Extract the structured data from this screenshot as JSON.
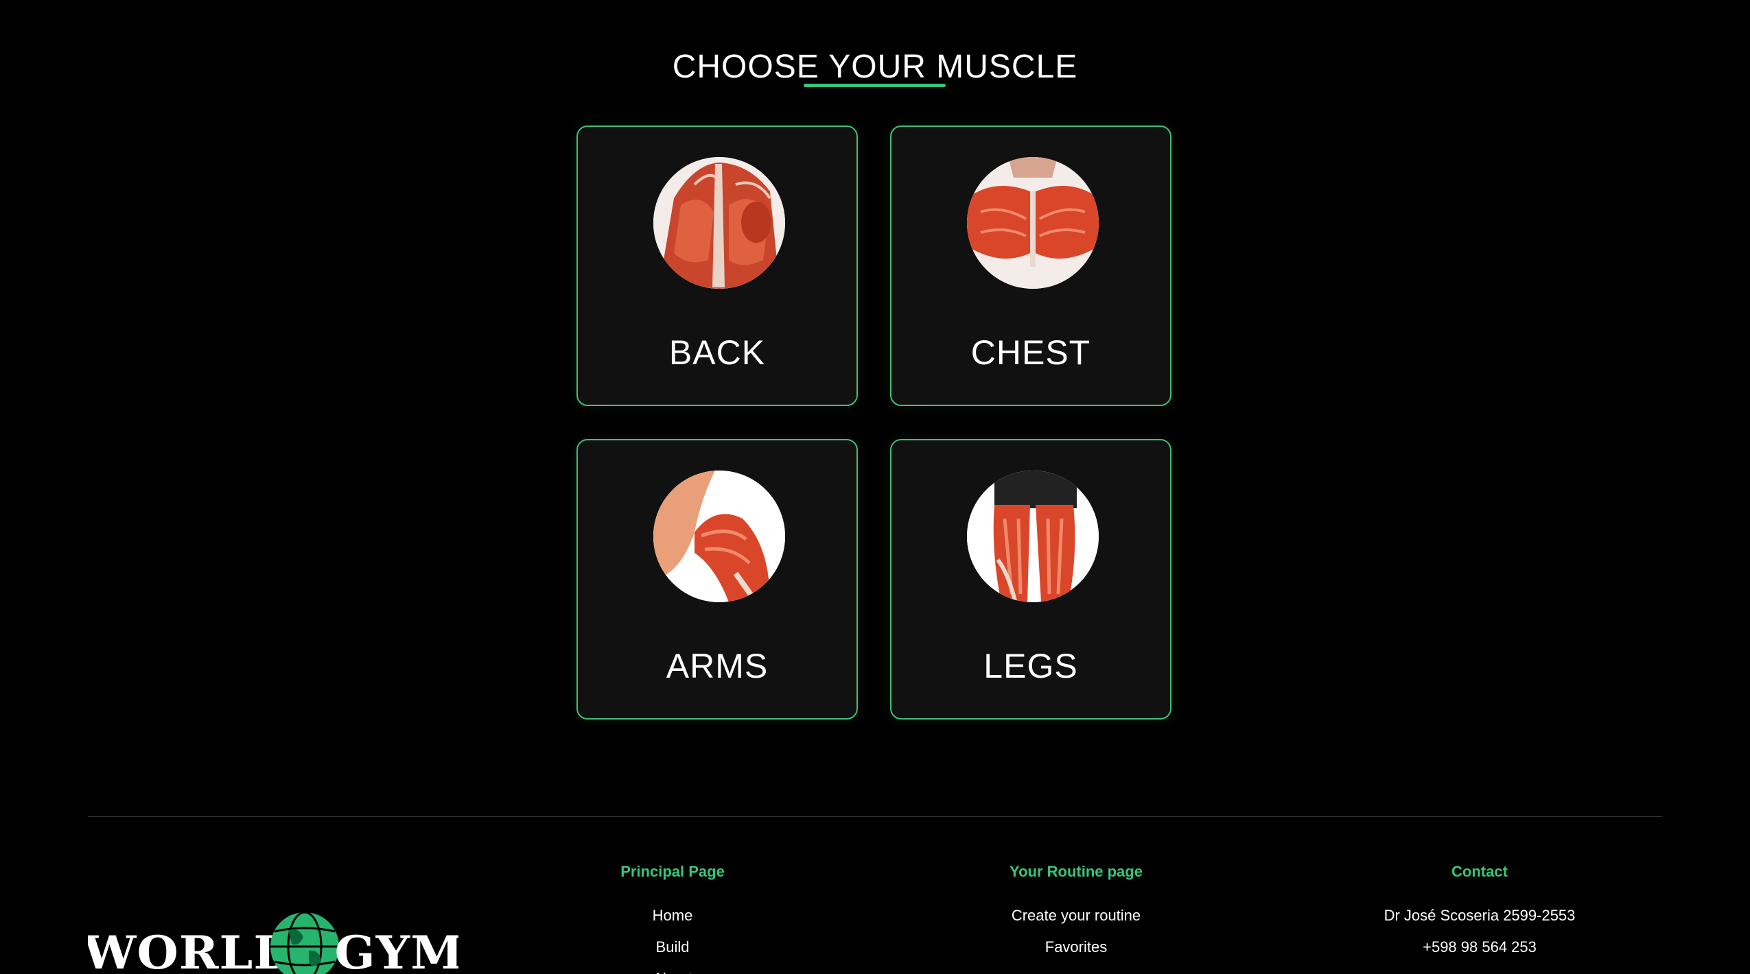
{
  "page": {
    "title": "CHOOSE YOUR MUSCLE"
  },
  "muscles": [
    {
      "label": "BACK"
    },
    {
      "label": "CHEST"
    },
    {
      "label": "ARMS"
    },
    {
      "label": "LEGS"
    }
  ],
  "footer": {
    "logo": {
      "left": "WORLD",
      "right": "GYM"
    },
    "columns": [
      {
        "heading": "Principal Page",
        "links": [
          "Home",
          "Build",
          "About"
        ]
      },
      {
        "heading": "Your Routine page",
        "links": [
          "Create your routine",
          "Favorites"
        ]
      },
      {
        "heading": "Contact",
        "items": [
          "Dr José Scoseria 2599-2553",
          "+598 98 564 253"
        ]
      }
    ]
  },
  "colors": {
    "accent": "#36c77b",
    "background": "#000000",
    "card": "#111111",
    "muscle": "#d9462a"
  }
}
